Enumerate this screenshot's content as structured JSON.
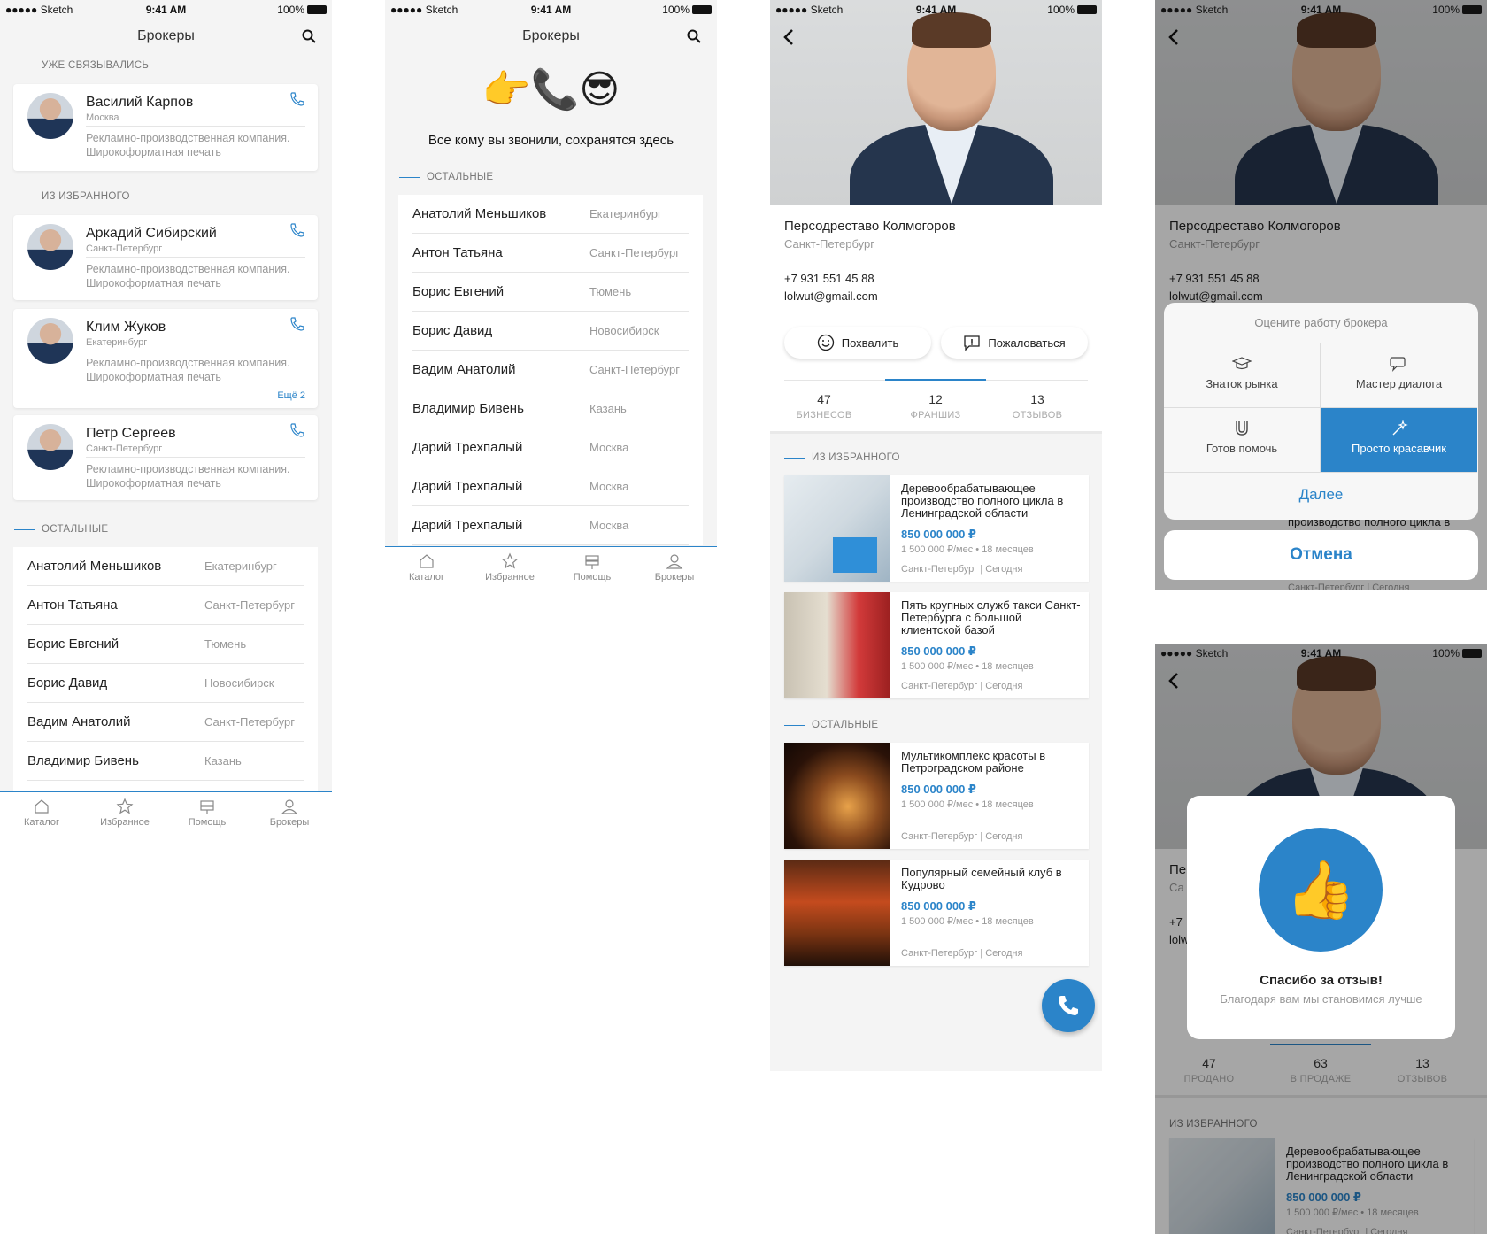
{
  "status": {
    "carrier": "●●●●● Sketch",
    "time": "9:41 AM",
    "battery": "100%"
  },
  "brokers_screen": {
    "title": "Брокеры",
    "section_contacted": "УЖЕ СВЯЗЫВАЛИСЬ",
    "section_favorites": "ИЗ ИЗБРАННОГО",
    "section_others": "ОСТАЛЬНЫЕ",
    "contacted": [
      {
        "name": "Василий Карпов",
        "city": "Москва",
        "desc": "Рекламно-производственная компания. Широкоформатная печать"
      }
    ],
    "favorites": [
      {
        "name": "Аркадий Сибирский",
        "city": "Санкт-Петербург",
        "desc": "Рекламно-производственная компания. Широкоформатная печать"
      },
      {
        "name": "Клим Жуков",
        "city": "Екатеринбург",
        "desc": "Рекламно-производственная компания. Широкоформатная печать",
        "more": "Ещё 2"
      },
      {
        "name": "Петр Сергеев",
        "city": "Санкт-Петербург",
        "desc": "Рекламно-производственная компания. Широкоформатная печать"
      }
    ],
    "others": [
      {
        "name": "Анатолий Меньшиков",
        "city": "Екатеринбург"
      },
      {
        "name": "Антон Татьяна",
        "city": "Санкт-Петербург"
      },
      {
        "name": "Борис Евгений",
        "city": "Тюмень"
      },
      {
        "name": "Борис Давид",
        "city": "Новосибирск"
      },
      {
        "name": "Вадим Анатолий",
        "city": "Санкт-Петербург"
      },
      {
        "name": "Владимир Бивень",
        "city": "Казань"
      },
      {
        "name": "Дарий Трехпалый",
        "city": "Москва"
      },
      {
        "name": "Дарий Трехпалый",
        "city": "Москва"
      },
      {
        "name": "Дарий Трехпалый",
        "city": "Москва"
      }
    ]
  },
  "empty_screen": {
    "emoji": "👉📞😎",
    "message": "Все кому вы звонили, сохранятся здесь"
  },
  "tabs": [
    "Каталог",
    "Избранное",
    "Помощь",
    "Брокеры"
  ],
  "profile": {
    "name": "Персодреставо Колмогоров",
    "city": "Санкт-Петербург",
    "phone": "+7 931 551 45 88",
    "email": "lolwut@gmail.com",
    "praise": "Похвалить",
    "complain": "Пожаловаться",
    "stats": [
      {
        "value": "47",
        "label": "БИЗНЕСОВ"
      },
      {
        "value": "12",
        "label": "ФРАНШИЗ"
      },
      {
        "value": "13",
        "label": "ОТЗЫВОВ"
      }
    ],
    "section_favorites": "ИЗ ИЗБРАННОГО",
    "section_others": "ОСТАЛЬНЫЕ",
    "listings": [
      {
        "title": "Деревообрабатывающее производство полного цикла в Ленинградской области",
        "price": "850 000 000 ₽",
        "sub": "1 500 000 ₽/мес  • 18 месяцев",
        "loc": "Санкт-Петербург  |  Сегодня"
      },
      {
        "title": "Пять крупных служб такси Санкт-Петербурга с большой клиентской базой",
        "price": "850 000 000 ₽",
        "sub": "1 500 000 ₽/мес  • 18 месяцев",
        "loc": "Санкт-Петербург  |  Сегодня"
      },
      {
        "title": "Мультикомплекс красоты в Петроградском районе",
        "price": "850 000 000 ₽",
        "sub": "1 500 000 ₽/мес  • 18 месяцев",
        "loc": "Санкт-Петербург  |  Сегодня"
      },
      {
        "title": "Популярный семейный клуб в Кудрово",
        "price": "850 000 000 ₽",
        "sub": "1 500 000 ₽/мес  • 18 месяцев",
        "loc": "Санкт-Петербург  |  Сегодня"
      }
    ]
  },
  "rating_sheet": {
    "header": "Оцените работу брокера",
    "options": [
      "Знаток рынка",
      "Мастер диалога",
      "Готов помочь",
      "Просто красавчик"
    ],
    "selected": "Просто красавчик",
    "next": "Далее",
    "cancel": "Отмена",
    "behind_text": "производство полного цикла в",
    "behind_loc": "Санкт-Петербург  |  Сегодня"
  },
  "thanks_screen": {
    "title": "Спасибо за отзыв!",
    "subtitle": "Благодаря вам мы становимся лучше",
    "emoji": "👍",
    "name_partial": "Пе",
    "city_partial": "Са",
    "phone_partial": "+7",
    "email_partial": "lolw",
    "stats": [
      {
        "value": "47",
        "label": "ПРОДАНО"
      },
      {
        "value": "63",
        "label": "В ПРОДАЖЕ"
      },
      {
        "value": "13",
        "label": "ОТЗЫВОВ"
      }
    ],
    "section": "ИЗ ИЗБРАННОГО",
    "listing": {
      "title": "Деревообрабатывающее производство полного цикла в Ленинградской области",
      "price": "850 000 000 ₽",
      "sub": "1 500 000 ₽/мес  • 18 месяцев",
      "loc": "Санкт-Петербург  |  Сегодня"
    }
  },
  "colors": {
    "accent": "#2b84c9",
    "background": "#f4f4f4"
  }
}
